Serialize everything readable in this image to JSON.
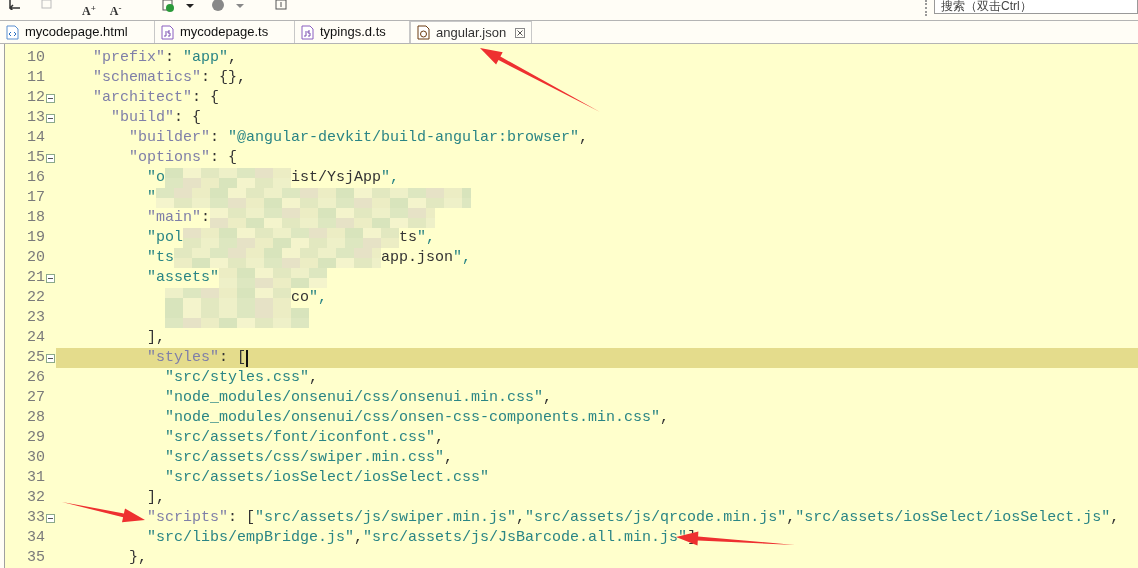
{
  "toolbar": {
    "font_buttons": [
      "A$^{+}$",
      "A$^{-}$"
    ],
    "search": {
      "placeholder": "搜索（双击Ctrl）"
    }
  },
  "tabs": [
    {
      "label": "mycodepage.html",
      "kind": "html",
      "selected": false,
      "closable": false
    },
    {
      "label": "mycodepage.ts",
      "kind": "js",
      "selected": false,
      "closable": false
    },
    {
      "label": "typings.d.ts",
      "kind": "js",
      "selected": false,
      "closable": false
    },
    {
      "label": "angular.json",
      "kind": "json",
      "selected": true,
      "closable": true
    }
  ],
  "editor": {
    "lines": [
      {
        "number": "10",
        "text": "    \"prefix\": \"app\",",
        "foldable": false,
        "current": false
      },
      {
        "number": "11",
        "text": "    \"schematics\": {},",
        "foldable": false,
        "current": false
      },
      {
        "number": "12",
        "text": "    \"architect\": {",
        "foldable": true,
        "current": false
      },
      {
        "number": "13",
        "text": "      \"build\": {",
        "foldable": true,
        "current": false
      },
      {
        "number": "14",
        "text": "        \"builder\": \"@angular-devkit/build-angular:browser\",",
        "foldable": false,
        "current": false
      },
      {
        "number": "15",
        "text": "        \"options\": {",
        "foldable": true,
        "current": false
      },
      {
        "number": "16",
        "parts": [
          {
            "kind": "code",
            "text": "          \"o"
          },
          {
            "kind": "blur"
          },
          {
            "kind": "code",
            "text": "ist/YsjApp\","
          }
        ],
        "foldable": false,
        "current": false
      },
      {
        "number": "17",
        "parts": [
          {
            "kind": "code",
            "text": "          \""
          },
          {
            "kind": "blur"
          }
        ],
        "foldable": false,
        "current": false
      },
      {
        "number": "18",
        "parts": [
          {
            "kind": "code",
            "text": "          \"main\":"
          },
          {
            "kind": "blur"
          }
        ],
        "foldable": false,
        "current": false
      },
      {
        "number": "19",
        "parts": [
          {
            "kind": "code",
            "text": "          \"pol"
          },
          {
            "kind": "blur"
          },
          {
            "kind": "code",
            "text": "ts\","
          }
        ],
        "foldable": false,
        "current": false
      },
      {
        "number": "20",
        "parts": [
          {
            "kind": "code",
            "text": "          \"ts"
          },
          {
            "kind": "blur"
          },
          {
            "kind": "code",
            "text": "app.json\","
          }
        ],
        "foldable": false,
        "current": false
      },
      {
        "number": "21",
        "parts": [
          {
            "kind": "code",
            "text": "          \"assets\""
          },
          {
            "kind": "blur"
          }
        ],
        "foldable": true,
        "current": false
      },
      {
        "number": "22",
        "parts": [
          {
            "kind": "blur"
          },
          {
            "kind": "code",
            "text": "co\","
          }
        ],
        "foldable": false,
        "current": false
      },
      {
        "number": "23",
        "parts": [
          {
            "kind": "blur"
          }
        ],
        "foldable": false,
        "current": false
      },
      {
        "number": "24",
        "text": "          ],",
        "foldable": false,
        "current": false
      },
      {
        "number": "25",
        "text": "          \"styles\": [",
        "foldable": true,
        "current": true
      },
      {
        "number": "26",
        "text": "            \"src/styles.css\",",
        "foldable": false,
        "current": false
      },
      {
        "number": "27",
        "text": "            \"node_modules/onsenui/css/onsenui.min.css\",",
        "foldable": false,
        "current": false
      },
      {
        "number": "28",
        "text": "            \"node_modules/onsenui/css/onsen-css-components.min.css\",",
        "foldable": false,
        "current": false
      },
      {
        "number": "29",
        "text": "            \"src/assets/font/iconfont.css\",",
        "foldable": false,
        "current": false
      },
      {
        "number": "30",
        "text": "            \"src/assets/css/swiper.min.css\",",
        "foldable": false,
        "current": false
      },
      {
        "number": "31",
        "text": "            \"src/assets/iosSelect/iosSelect.css\"",
        "foldable": false,
        "current": false
      },
      {
        "number": "32",
        "text": "          ],",
        "foldable": false,
        "current": false
      },
      {
        "number": "33",
        "text": "          \"scripts\": [\"src/assets/js/swiper.min.js\",\"src/assets/js/qrcode.min.js\",\"src/assets/iosSelect/iosSelect.js\",",
        "foldable": true,
        "current": false
      },
      {
        "number": "34",
        "text": "          \"src/libs/empBridge.js\",\"src/assets/js/JsBarcode.all.min.js\"]",
        "foldable": false,
        "current": false
      },
      {
        "number": "35",
        "text": "        },",
        "foldable": false,
        "current": false
      }
    ]
  },
  "annotations": [
    {
      "kind": "arrow"
    },
    {
      "kind": "arrow"
    },
    {
      "kind": "arrow"
    }
  ]
}
